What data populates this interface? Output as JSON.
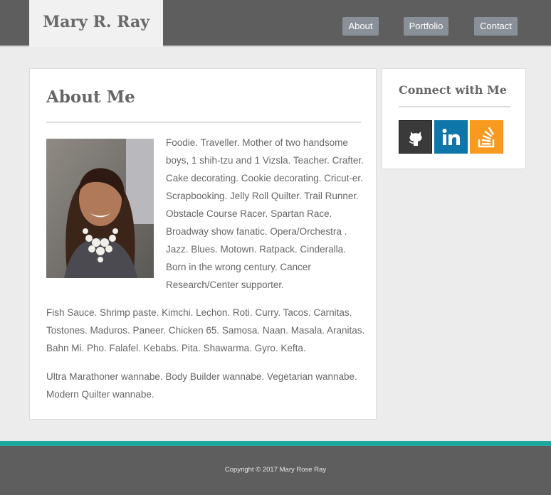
{
  "header": {
    "brand": "Mary R. Ray",
    "nav": [
      {
        "label": "About"
      },
      {
        "label": "Portfolio"
      },
      {
        "label": "Contact"
      }
    ]
  },
  "about": {
    "title": "About Me",
    "paragraphs": [
      "Foodie. Traveller. Mother of two handsome boys, 1 shih-tzu and 1 Vizsla. Teacher. Crafter. Cake decorating. Cookie decorating. Cricut-er. Scrapbooking. Jelly Roll Quilter. Trail Runner. Obstacle Course Racer. Spartan Race. Broadway show fanatic. Opera/Orchestra . Jazz. Blues. Motown. Ratpack. Cinderalla. Born in the wrong century. Cancer Research/Center supporter.",
      "Fish Sauce. Shrimp paste. Kimchi. Lechon. Roti. Curry. Tacos. Carnitas. Tostones. Maduros. Paneer. Chicken 65. Samosa. Naan. Masala. Aranitas. Bahn Mi. Pho. Falafel. Kebabs. Pita. Shawarma. Gyro. Kefta.",
      "Ultra Marathoner wannabe. Body Builder wannabe. Vegetarian wannabe. Modern Quilter wannabe."
    ]
  },
  "connect": {
    "title": "Connect with Me",
    "links": [
      {
        "icon": "github-icon",
        "color": "#3a3a3a"
      },
      {
        "icon": "linkedin-icon",
        "color": "#0e76a8"
      },
      {
        "icon": "stackoverflow-icon",
        "color": "#f79a1e"
      }
    ]
  },
  "footer": {
    "copyright": "Copyright © 2017 Mary Rose Ray",
    "accent_color": "#1fa99f"
  }
}
